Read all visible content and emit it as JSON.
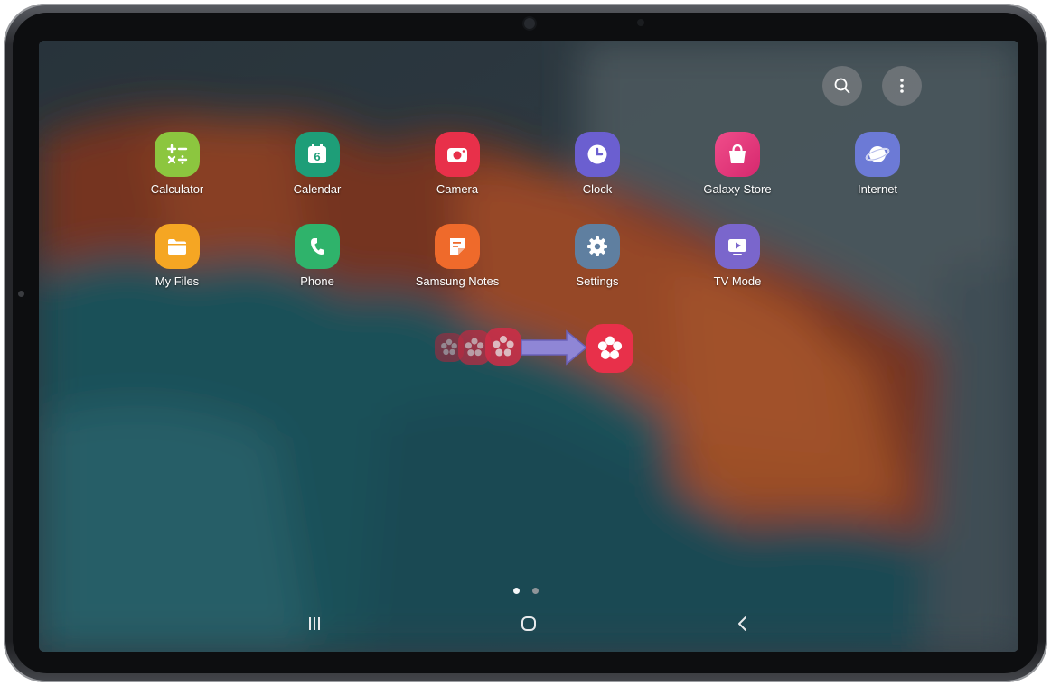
{
  "device": "Samsung Galaxy Tab",
  "toolbar": {
    "search_icon": "search-icon",
    "more_icon": "more-vertical-icon"
  },
  "apps": [
    {
      "label": "Calculator",
      "icon": "calculator-icon",
      "color": "#8cc63f"
    },
    {
      "label": "Calendar",
      "icon": "calendar-icon",
      "color": "#1e9e78",
      "badge": "6"
    },
    {
      "label": "Camera",
      "icon": "camera-icon",
      "color": "#e8304a"
    },
    {
      "label": "Clock",
      "icon": "clock-icon",
      "color": "#6b5fd0"
    },
    {
      "label": "Galaxy Store",
      "icon": "galaxy-store-icon",
      "color": "#e8377c"
    },
    {
      "label": "Internet",
      "icon": "internet-icon",
      "color": "#6c7ad6"
    },
    {
      "label": "My Files",
      "icon": "folder-icon",
      "color": "#f5a623"
    },
    {
      "label": "Phone",
      "icon": "phone-icon",
      "color": "#2fb36b"
    },
    {
      "label": "Samsung Notes",
      "icon": "notes-icon",
      "color": "#ef6a2b"
    },
    {
      "label": "Settings",
      "icon": "settings-icon",
      "color": "#5f7fa0"
    },
    {
      "label": "TV Mode",
      "icon": "tv-icon",
      "color": "#7a66cc"
    }
  ],
  "drag_hint": {
    "icon": "bixby-flower-icon",
    "color": "#e8304a",
    "arrow_color": "#8f86d6"
  },
  "pages": {
    "count": 2,
    "current": 1
  },
  "navbar": {
    "recents": "recents-icon",
    "home": "home-icon",
    "back": "back-icon"
  }
}
